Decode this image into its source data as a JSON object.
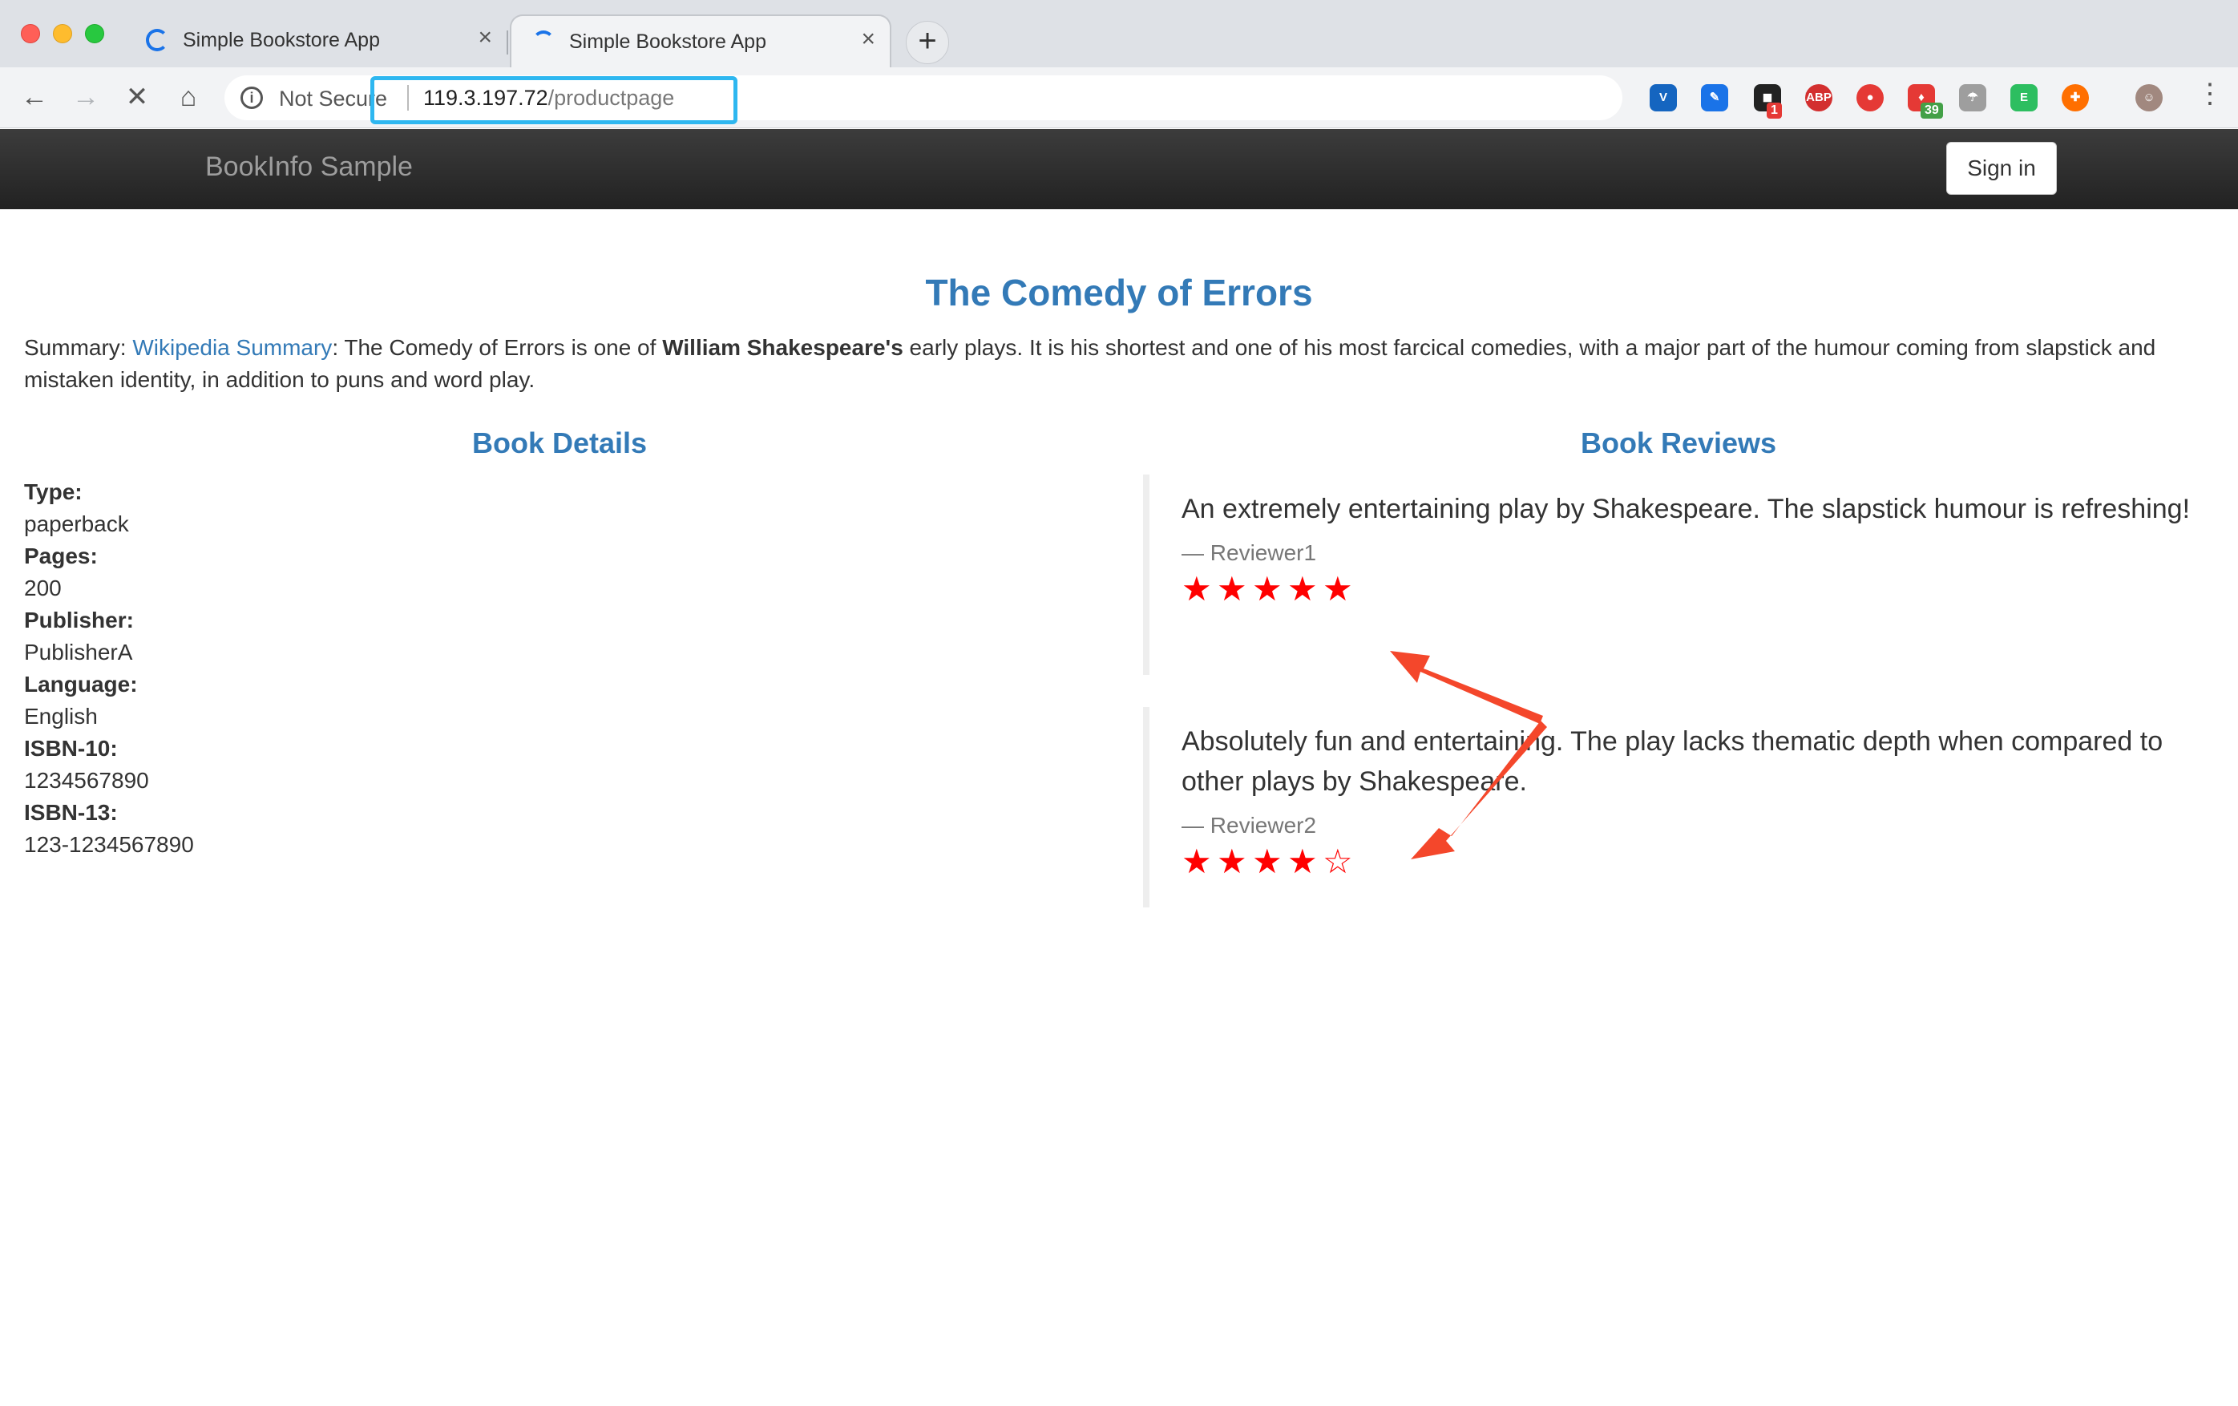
{
  "browser": {
    "tabs": [
      {
        "title": "Simple Bookstore App",
        "active": false
      },
      {
        "title": "Simple Bookstore App",
        "active": true
      }
    ],
    "new_tab_label": "+",
    "security_label": "Not Secure",
    "url_host": "119.3.197.72",
    "url_path": "/productpage",
    "extensions": [
      {
        "name": "vimium-icon",
        "color": "#1565c0",
        "glyph": "V"
      },
      {
        "name": "pen-icon",
        "color": "#1a73e8",
        "glyph": "✎"
      },
      {
        "name": "camera-icon",
        "color": "#222222",
        "glyph": "◼",
        "badge": "1",
        "badge_color": "#e53935"
      },
      {
        "name": "adblock-icon",
        "color": "#d32f2f",
        "glyph": "ABP"
      },
      {
        "name": "record-icon",
        "color": "#e53935",
        "glyph": "●"
      },
      {
        "name": "pepper-icon",
        "color": "#e53935",
        "glyph": "♦",
        "badge": "39",
        "badge_color": "#43a047"
      },
      {
        "name": "parachute-icon",
        "color": "#9e9e9e",
        "glyph": "☂"
      },
      {
        "name": "evernote-icon",
        "color": "#2dbe60",
        "glyph": "E"
      },
      {
        "name": "lifebuoy-icon",
        "color": "#ff6f00",
        "glyph": "✚"
      },
      {
        "name": "profile-avatar-icon",
        "color": "#a1887f",
        "glyph": "☺"
      }
    ]
  },
  "nav": {
    "brand": "BookInfo Sample",
    "signin_label": "Sign in"
  },
  "book": {
    "title": "The Comedy of Errors",
    "summary_prefix": "Summary: ",
    "summary_link": "Wikipedia Summary",
    "summary_mid": ": The Comedy of Errors is one of ",
    "summary_bold": "William Shakespeare's",
    "summary_rest": " early plays. It is his shortest and one of his most farcical comedies, with a major part of the humour coming from slapstick and mistaken identity, in addition to puns and word play."
  },
  "details": {
    "heading": "Book Details",
    "type_label": "Type:",
    "type_value": "paperback",
    "pages_label": "Pages:",
    "pages_value": "200",
    "publisher_label": "Publisher:",
    "publisher_value": "PublisherA",
    "language_label": "Language:",
    "language_value": "English",
    "isbn10_label": "ISBN-10:",
    "isbn10_value": "1234567890",
    "isbn13_label": "ISBN-13:",
    "isbn13_value": "123-1234567890"
  },
  "reviews": {
    "heading": "Book Reviews",
    "star_color": "#ff0000",
    "items": [
      {
        "text": "An extremely entertaining play by Shakespeare. The slapstick humour is refreshing!",
        "reviewer": "— Reviewer1",
        "rating": 5,
        "max": 5
      },
      {
        "text": "Absolutely fun and entertaining. The play lacks thematic depth when compared to other plays by Shakespeare.",
        "reviewer": "— Reviewer2",
        "rating": 4,
        "max": 5
      }
    ]
  },
  "annotations": {
    "arrow_color": "#f4472b",
    "highlight_color": "#2eb7f0"
  }
}
